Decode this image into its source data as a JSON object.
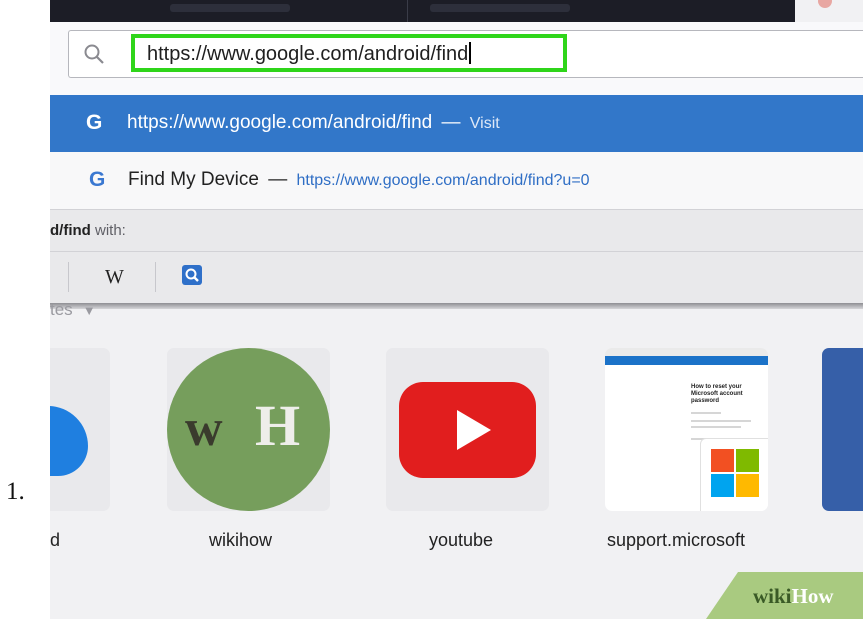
{
  "list_marker": "1.",
  "address_bar": {
    "value": "https://www.google.com/android/find"
  },
  "suggestions": [
    {
      "main": "https://www.google.com/android/find",
      "separator": "—",
      "action": "Visit",
      "icon": "google-g-icon"
    },
    {
      "main": "Find My Device",
      "separator": "—",
      "url": "https://www.google.com/android/find?u=0",
      "icon": "google-g-icon"
    }
  ],
  "search_with": {
    "query_fragment": "d/find",
    "suffix": " with:"
  },
  "engines": [
    {
      "label": "W",
      "icon": "wikipedia-icon"
    },
    {
      "label": "",
      "icon": "search-engine-icon"
    }
  ],
  "top_sites": {
    "label": "tes",
    "tiles": [
      {
        "label": "d",
        "icon": "cloud-icon"
      },
      {
        "label": "wikihow",
        "icon": "wikihow-logo",
        "logo_text": "wH"
      },
      {
        "label": "youtube",
        "icon": "youtube-logo"
      },
      {
        "label": "support.microsoft",
        "icon": "microsoft-logo",
        "thumb_title": "How to reset your Microsoft account password"
      }
    ]
  },
  "watermark": {
    "wiki": "wiki",
    "how": "How"
  },
  "colors": {
    "highlight_border": "#2fd51a",
    "selected_row": "#3277c9",
    "youtube_red": "#e11e1e",
    "wikihow_green": "#769e5c"
  }
}
